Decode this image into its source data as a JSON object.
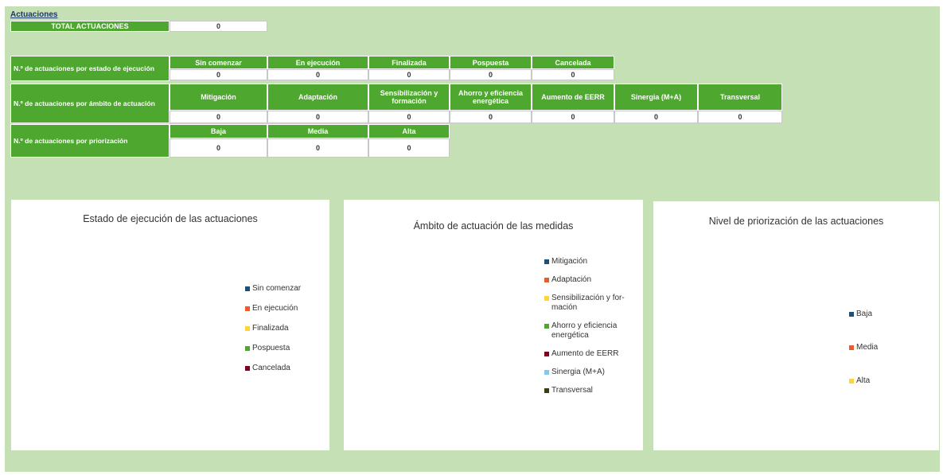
{
  "title": "Actuaciones",
  "total": {
    "label": "TOTAL ACTUACIONES",
    "value": "0"
  },
  "estado": {
    "label": "N.º de actuaciones por estado de ejecución",
    "headers": [
      "Sin comenzar",
      "En ejecución",
      "Finalizada",
      "Pospuesta",
      "Cancelada"
    ],
    "values": [
      "0",
      "0",
      "0",
      "0",
      "0"
    ]
  },
  "ambito": {
    "label": "N.º de actuaciones por ámbito de actuación",
    "headers": [
      "Mitigación",
      "Adaptación",
      "Sensibilización y formación",
      "Ahorro y eficiencia energética",
      "Aumento de EERR",
      "Sinergia (M+A)",
      "Transversal"
    ],
    "values": [
      "0",
      "0",
      "0",
      "0",
      "0",
      "0",
      "0"
    ]
  },
  "priorizacion": {
    "label": "N.º de actuaciones por priorización",
    "headers": [
      "Baja",
      "Media",
      "Alta"
    ],
    "values": [
      "0",
      "0",
      "0"
    ]
  },
  "chart_data": [
    {
      "type": "pie",
      "title": "Estado de ejecución de las actuaciones",
      "categories": [
        "Sin comenzar",
        "En ejecución",
        "Finalizada",
        "Pospuesta",
        "Cancelada"
      ],
      "values": [
        0,
        0,
        0,
        0,
        0
      ],
      "colors": [
        "#1f4e79",
        "#ed5a2b",
        "#ffd43a",
        "#4ea72e",
        "#800020"
      ],
      "legend": "right"
    },
    {
      "type": "pie",
      "title": "Ámbito de actuación de las medidas",
      "categories": [
        "Mitigación",
        "Adaptación",
        "Sensibilización y for-\nmación",
        "Ahorro y eficiencia\nenergética",
        "Aumento de EERR",
        "Sinergia (M+A)",
        "Transversal"
      ],
      "values": [
        0,
        0,
        0,
        0,
        0,
        0,
        0
      ],
      "colors": [
        "#1f4e79",
        "#ed5a2b",
        "#ffd43a",
        "#4ea72e",
        "#800020",
        "#7ec8f2",
        "#334011"
      ],
      "legend": "right"
    },
    {
      "type": "pie",
      "title": "Nivel de priorización de las actuaciones",
      "categories": [
        "Baja",
        "Media",
        "Alta"
      ],
      "values": [
        0,
        0,
        0
      ],
      "colors": [
        "#1f4e79",
        "#ed5a2b",
        "#ffd43a"
      ],
      "legend": "right"
    }
  ]
}
